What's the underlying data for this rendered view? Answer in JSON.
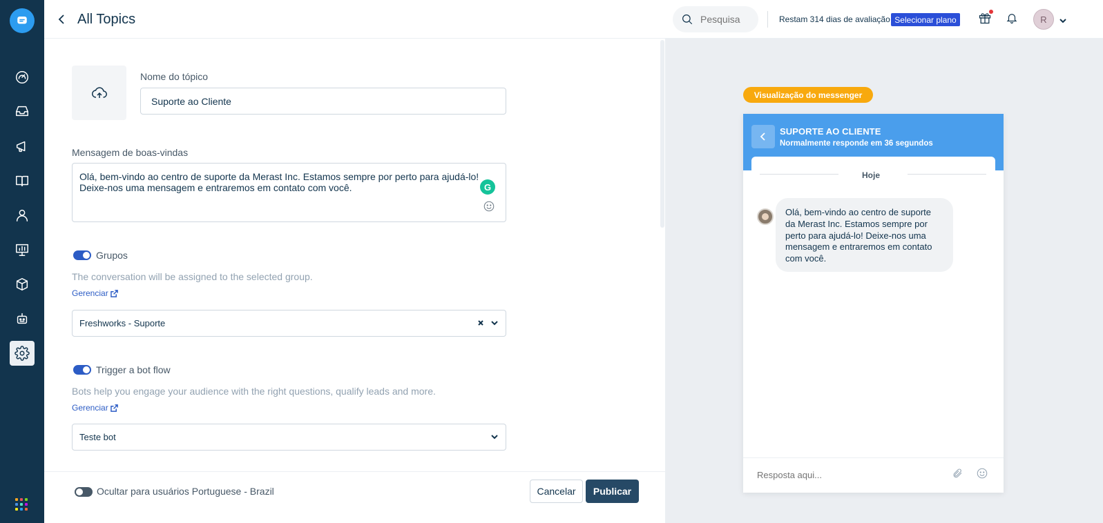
{
  "header": {
    "title": "All Topics",
    "search_placeholder": "Pesquisa",
    "trial_text": "Restam 314 dias de avaliação",
    "plan_button": "Selecionar plano",
    "avatar_initial": "R"
  },
  "form": {
    "topic_name_label": "Nome do tópico",
    "topic_name_value": "Suporte ao Cliente",
    "welcome_label": "Mensagem de boas-vindas",
    "welcome_message": "Olá, bem-vindo ao centro de suporte da Merast Inc. Estamos sempre por perto para ajudá-lo! Deixe-nos uma mensagem e entraremos em contato com você.",
    "groups": {
      "label": "Grupos",
      "help": "The conversation will be assigned to the selected group.",
      "manage": "Gerenciar",
      "selected": "Freshworks - Suporte"
    },
    "bot": {
      "label": "Trigger a bot flow",
      "help": "Bots help you engage your audience with the right questions, qualify leads and more.",
      "manage": "Gerenciar",
      "selected": "Teste bot"
    },
    "hide_label": "Ocultar para usuários Portuguese - Brazil",
    "cancel": "Cancelar",
    "publish": "Publicar"
  },
  "preview": {
    "badge": "Visualização do messenger",
    "title": "SUPORTE AO CLIENTE",
    "subtitle": "Normalmente responde em 36 segundos",
    "today": "Hoje",
    "bubble_text": "Olá, bem-vindo ao centro de suporte da Merast Inc. Estamos sempre por perto para ajudá-lo! Deixe-nos uma mensagem e entraremos em contato com você.",
    "reply_placeholder": "Resposta aqui..."
  },
  "colors": {
    "nav_bg": "#12344d",
    "accent": "#2c5cc5",
    "messenger_header": "#4a9eec",
    "badge": "#f8a90e"
  }
}
